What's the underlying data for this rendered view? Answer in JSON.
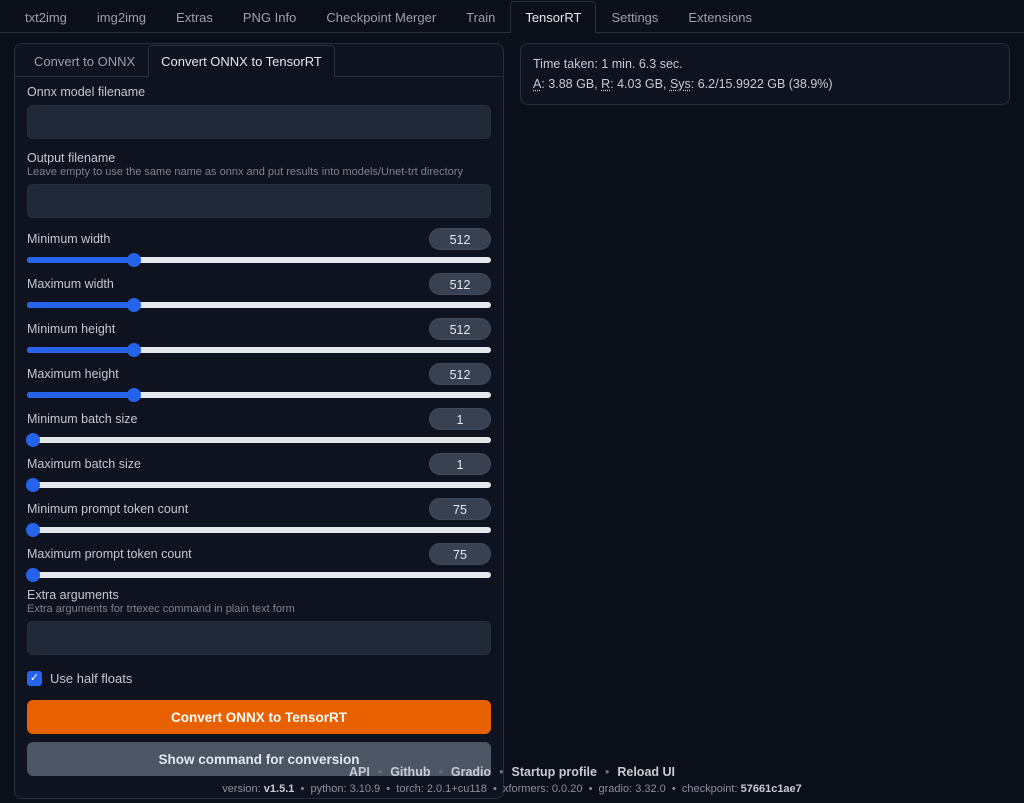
{
  "top_tabs": [
    "txt2img",
    "img2img",
    "Extras",
    "PNG Info",
    "Checkpoint Merger",
    "Train",
    "TensorRT",
    "Settings",
    "Extensions"
  ],
  "top_tab_active": 6,
  "sub_tabs": [
    "Convert to ONNX",
    "Convert ONNX to TensorRT"
  ],
  "sub_tab_active": 1,
  "onnx": {
    "label": "Onnx model filename",
    "value": ""
  },
  "output": {
    "label": "Output filename",
    "help": "Leave empty to use the same name as onnx and put results into models/Unet-trt directory",
    "value": ""
  },
  "sliders": [
    {
      "label": "Minimum width",
      "value": 512,
      "pct": 23
    },
    {
      "label": "Maximum width",
      "value": 512,
      "pct": 23
    },
    {
      "label": "Minimum height",
      "value": 512,
      "pct": 23
    },
    {
      "label": "Maximum height",
      "value": 512,
      "pct": 23
    },
    {
      "label": "Minimum batch size",
      "value": 1,
      "pct": 1.3
    },
    {
      "label": "Maximum batch size",
      "value": 1,
      "pct": 1.3
    },
    {
      "label": "Minimum prompt token count",
      "value": 75,
      "pct": 1.3
    },
    {
      "label": "Maximum prompt token count",
      "value": 75,
      "pct": 1.3
    }
  ],
  "extra": {
    "label": "Extra arguments",
    "help": "Extra arguments for trtexec command in plain text form",
    "value": ""
  },
  "half_floats": {
    "label": "Use half floats",
    "checked": true
  },
  "buttons": {
    "convert": "Convert ONNX to TensorRT",
    "show": "Show command for conversion"
  },
  "status": {
    "time_label": "Time taken:",
    "time_value": "1 min. 6.3 sec.",
    "a_label": "A",
    "a_value": "3.88 GB",
    "r_label": "R",
    "r_value": "4.03 GB",
    "sys_label": "Sys",
    "sys_value": "6.2/15.9922 GB (38.9%)"
  },
  "footer_links": [
    "API",
    "Github",
    "Gradio",
    "Startup profile",
    "Reload UI"
  ],
  "version": {
    "prefix": "version:",
    "version": "v1.5.1",
    "python": "python: 3.10.9",
    "torch": "torch: 2.0.1+cu118",
    "xformers": "xformers: 0.0.20",
    "gradio": "gradio: 3.32.0",
    "checkpoint_label": "checkpoint:",
    "checkpoint": "57661c1ae7"
  }
}
